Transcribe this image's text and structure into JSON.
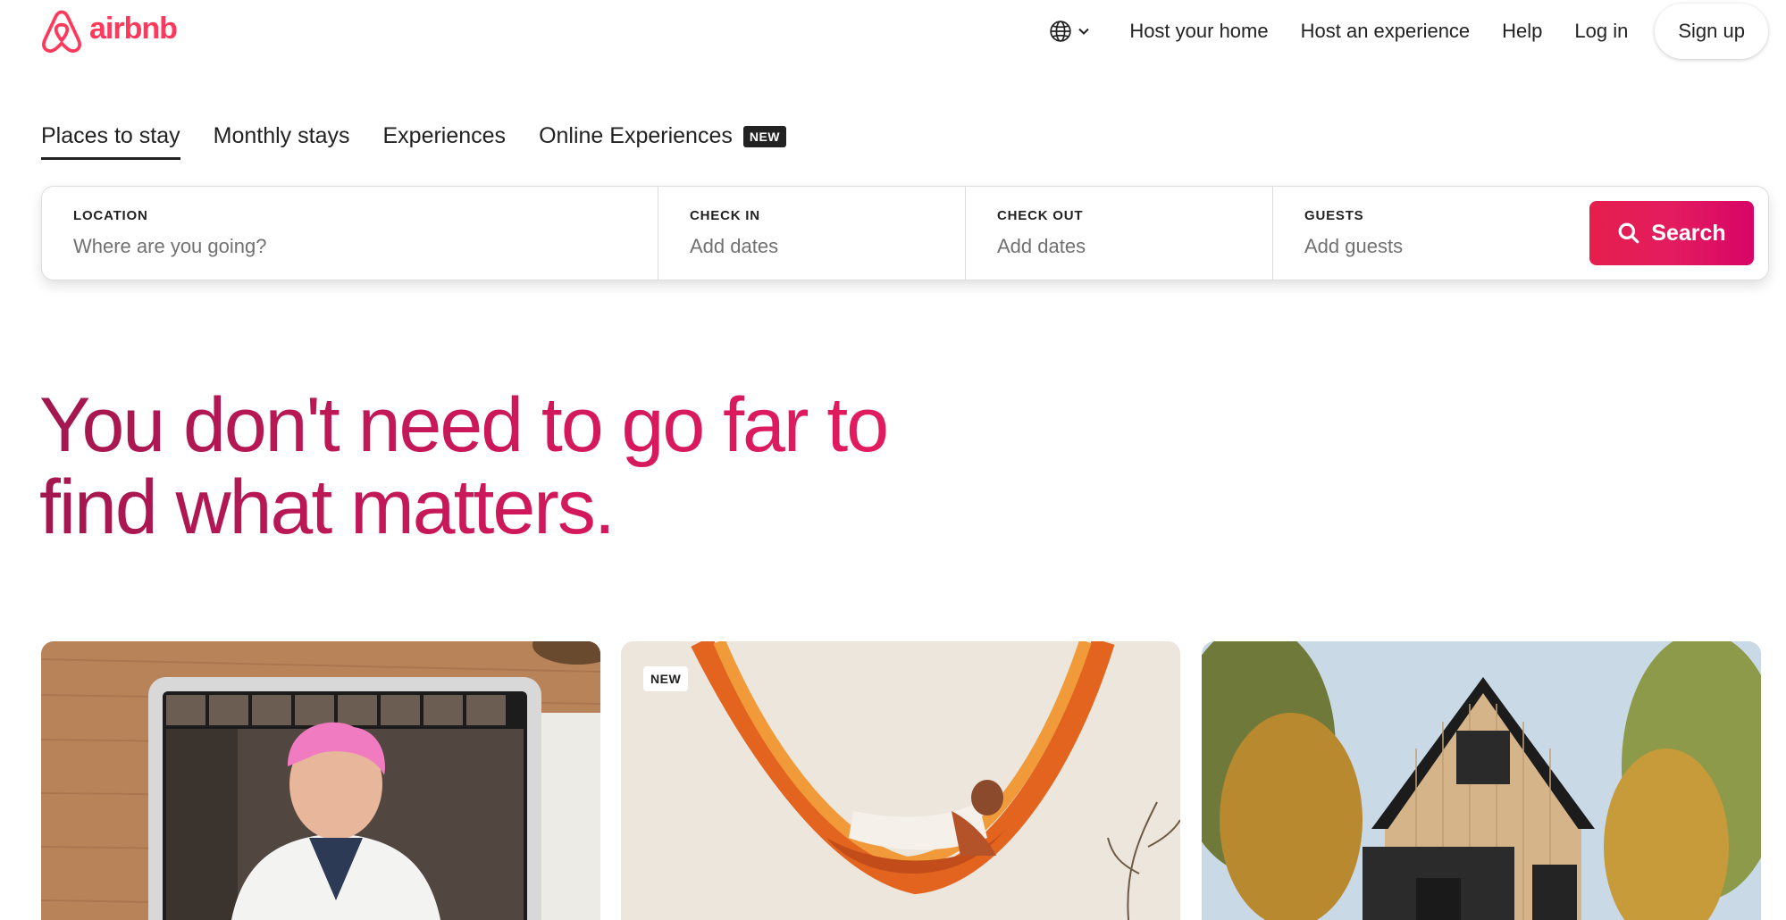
{
  "brand": {
    "name": "airbnb",
    "color": "#ff385c",
    "icon": "airbnb-belo-icon"
  },
  "header": {
    "language_icon": "globe-icon",
    "nav_links": [
      "Host your home",
      "Host an experience",
      "Help",
      "Log in"
    ],
    "signup_label": "Sign up"
  },
  "tabs": [
    {
      "label": "Places to stay",
      "active": true
    },
    {
      "label": "Monthly stays",
      "active": false
    },
    {
      "label": "Experiences",
      "active": false
    },
    {
      "label": "Online Experiences",
      "active": false,
      "badge": "NEW"
    }
  ],
  "search": {
    "location": {
      "label": "LOCATION",
      "placeholder": "Where are you going?"
    },
    "check_in": {
      "label": "CHECK IN",
      "placeholder": "Add dates"
    },
    "check_out": {
      "label": "CHECK OUT",
      "placeholder": "Add dates"
    },
    "guests": {
      "label": "GUESTS",
      "placeholder": "Add guests"
    },
    "button_label": "Search",
    "button_color": "#e61e4d"
  },
  "hero": {
    "line1": "You don't need to go far to",
    "line2": "find what matters."
  },
  "cards": [
    {
      "image": "chef-on-tablet-video-call"
    },
    {
      "image": "woman-in-orange-hammock",
      "badge": "NEW"
    },
    {
      "image": "wooden-a-frame-cabin-in-forest"
    }
  ]
}
